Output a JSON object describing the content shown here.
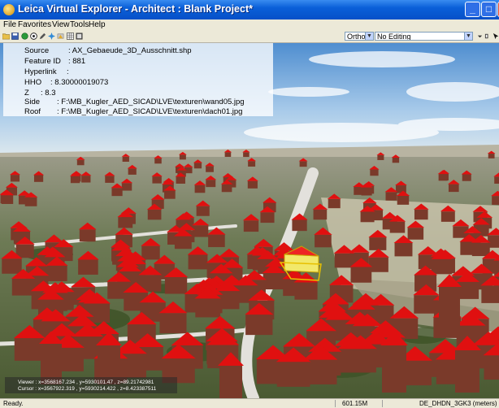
{
  "window": {
    "title": "Leica Virtual Explorer - Architect : Blank Project*",
    "minimize": "_",
    "maximize": "□",
    "close": "X"
  },
  "menu": {
    "items": [
      "File",
      "Favorites",
      "View",
      "Tools",
      "Help"
    ]
  },
  "toolbar": {
    "icons": [
      "folder-icon",
      "save-icon",
      "globe-icon",
      "target-icon",
      "pencil-icon",
      "magic-icon",
      "camera-icon",
      "grid-icon",
      "table-icon"
    ],
    "projection": "Ortho",
    "edit_mode": "No Editing"
  },
  "info": {
    "fields": [
      {
        "key": "Source",
        "value": ": AX_Gebaeude_3D_Ausschnitt.shp"
      },
      {
        "key": "Feature ID",
        "value": ": 881"
      },
      {
        "key": "Hyperlink",
        "value": ":"
      },
      {
        "key": "HHO",
        "value": ": 8.30000019073"
      },
      {
        "key": "Z",
        "value": ": 8.3"
      },
      {
        "key": "Side",
        "value": ": F:\\MB_Kugler_AED_SICAD\\LVE\\texturen\\wand05.jpg"
      },
      {
        "key": "Roof",
        "value": ": F:\\MB_Kugler_AED_SICAD\\LVE\\texturen\\dach01.jpg"
      }
    ]
  },
  "coords": {
    "viewer": "Viewer : x=3568167.234 , y=5930101.47 , z=89.21742981",
    "cursor": "Cursor : x=3567922.319 , y=5930214.422 , z=8.423387511"
  },
  "status": {
    "text": "Ready.",
    "size": "601.15M",
    "crs": "DE_DHDN_3GK3 (meters)"
  },
  "colors": {
    "title_bar": "#0a5fd8",
    "roof": "#e01010",
    "wall": "#7a3a2a",
    "sky": "#9cc4ec"
  }
}
